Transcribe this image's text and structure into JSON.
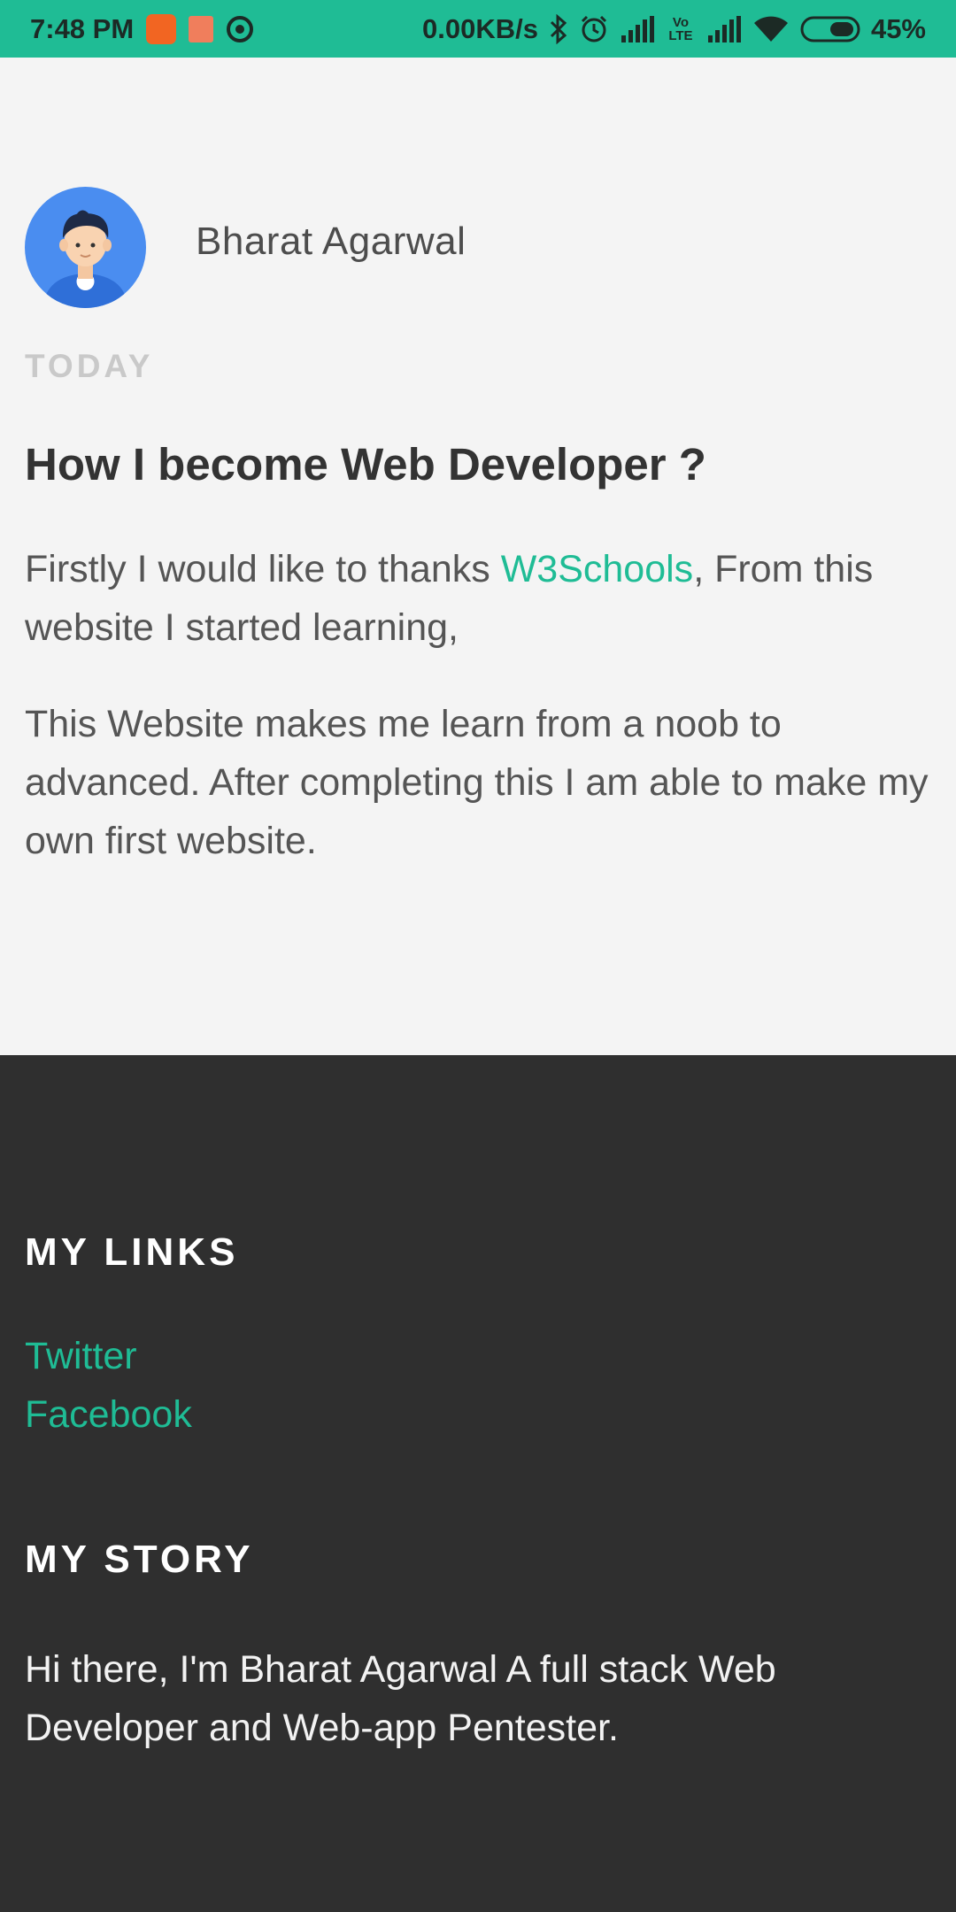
{
  "status_bar": {
    "time": "7:48 PM",
    "network_speed": "0.00KB/s",
    "battery": "45%",
    "lte_label": "Vo LTE",
    "icons": [
      "app-orange-icon",
      "app-mi-icon",
      "chrome-icon",
      "bluetooth-icon",
      "alarm-icon",
      "signal-icon",
      "lte-icon",
      "signal-icon",
      "wifi-icon",
      "battery-icon"
    ],
    "colors": {
      "background": "#1fbc95"
    }
  },
  "article": {
    "author": "Bharat Agarwal",
    "date": "TODAY",
    "title": "How I become Web Developer ?",
    "p1_before": "Firstly I would like to thanks ",
    "p1_link": "W3Schools",
    "p1_after": ", From this website I started learning,",
    "p2": "This Website makes me learn from a noob to advanced. After completing this I am able to make my own first website."
  },
  "footer": {
    "links_heading": "MY LINKS",
    "links": [
      "Twitter",
      "Facebook"
    ],
    "story_heading": "MY STORY",
    "story_text": "Hi there, I'm Bharat Agarwal A full stack Web Developer and Web-app Pentester."
  },
  "colors": {
    "accent": "#1fbc95",
    "footer_bg": "#2f2f2f",
    "page_bg": "#f4f4f4"
  }
}
